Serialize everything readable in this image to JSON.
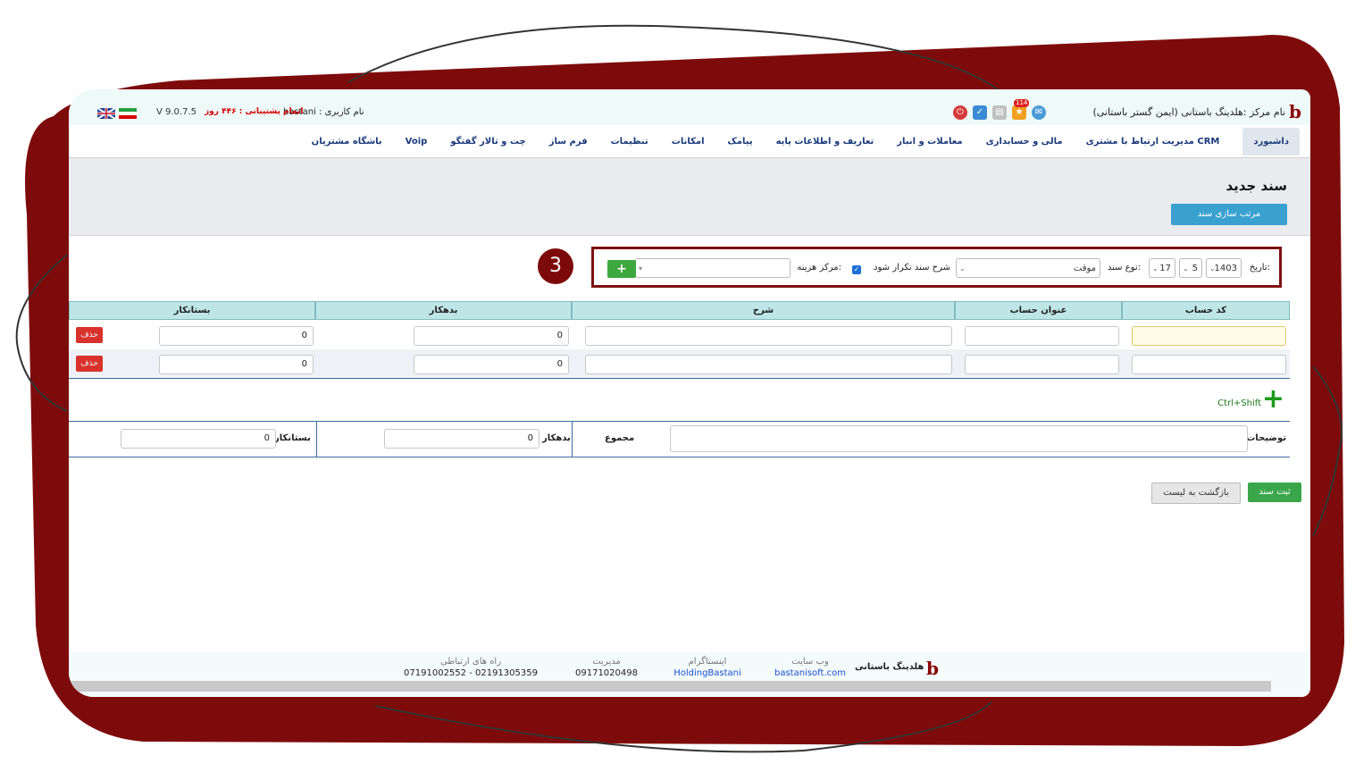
{
  "topbar": {
    "brand": "نام مرکز :هلدینگ باستانی (ایمن گستر باستانی)",
    "notification_count": "114",
    "user_label": "نام کاربری : bastani",
    "support": "اتمام پشتیبانی : ۴۴۶ روز",
    "version": "V 9.0.7.5"
  },
  "nav": {
    "items": [
      "داشبورد",
      "مدیریت ارتباط با مشتری CRM",
      "مالی و حسابداری",
      "معاملات و انبار",
      "تعاریف و اطلاعات پایه",
      "پیامک",
      "امکانات",
      "تنظیمات",
      "فرم ساز",
      "چت و تالار گفتگو",
      "Voip",
      "باشگاه مشتریان"
    ]
  },
  "page": {
    "title": "سند جدید",
    "sort_button": "مرتب سازی سند"
  },
  "filters": {
    "date_label": "تاریخ:",
    "year": "1403",
    "month": "5",
    "day": "17",
    "doc_type_label": "نوع سند:",
    "doc_type_value": "موقت",
    "repeat_label": "شرح سند تکرار شود",
    "cost_center_label": "مرکز هزینه:",
    "add_label": "+",
    "step_number": "3"
  },
  "table": {
    "headers": [
      "کد حساب",
      "عنوان حساب",
      "شرح",
      "بدهکار",
      "بستانکار"
    ],
    "rows": [
      {
        "debit": "0",
        "credit": "0",
        "delete": "حذف"
      },
      {
        "debit": "0",
        "credit": "0",
        "delete": "حذف"
      }
    ],
    "shortcut": "Ctrl+Shift"
  },
  "totals": {
    "notes_label": "توضیحات",
    "sum_label": "مجموع",
    "debit_label": "بدهکار",
    "debit_value": "0",
    "credit_label": "بستانکار",
    "credit_value": "0"
  },
  "actions": {
    "submit": "ثبت سند",
    "back": "بازگشت به لیست"
  },
  "footer": {
    "company": "هلدینگ باستانی",
    "website_label": "وب سایت",
    "website": "bastanisoft.com",
    "instagram_label": "اینستاگرام",
    "instagram": "HoldingBastani",
    "management_label": "مدیریت",
    "management": "09171020498",
    "contact_label": "راه های ارتباطی",
    "contact": "07191002552 - 02191305359"
  }
}
